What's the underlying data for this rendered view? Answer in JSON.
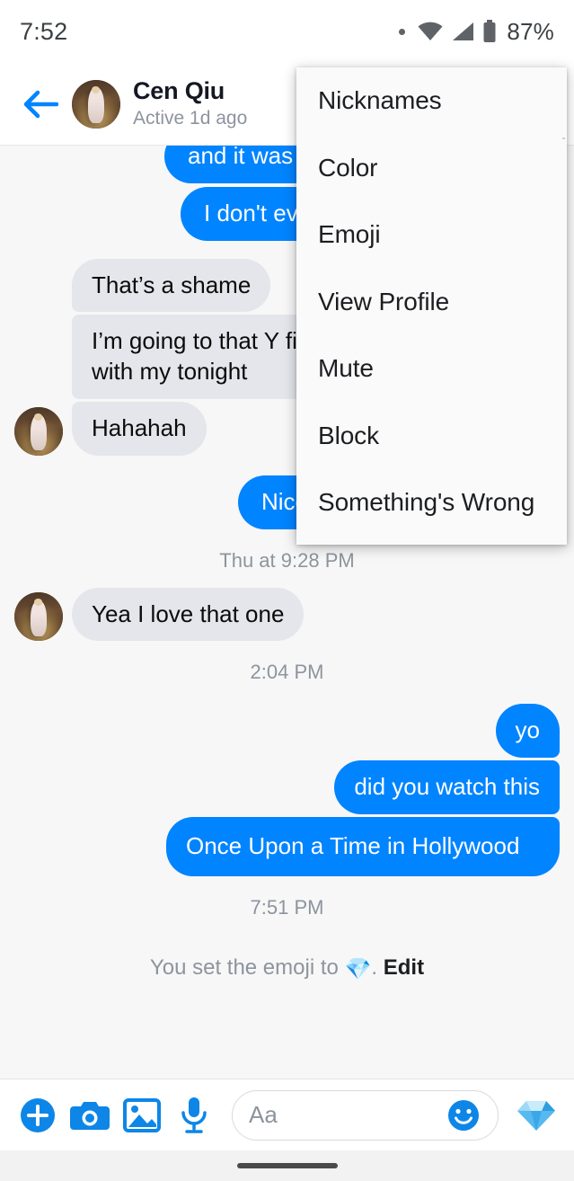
{
  "status_bar": {
    "clock": "7:52",
    "battery_percent": "87%",
    "icons": [
      "dot-indicator-icon",
      "wifi-icon",
      "cell-signal-icon",
      "battery-icon"
    ]
  },
  "header": {
    "back_icon": "back-arrow-icon",
    "name": "Cen Qiu",
    "active_status": "Active 1d ago"
  },
  "popup_menu": {
    "items": [
      {
        "label": "Nicknames"
      },
      {
        "label": "Color"
      },
      {
        "label": "Emoji"
      },
      {
        "label": "View Profile"
      },
      {
        "label": "Mute"
      },
      {
        "label": "Block"
      },
      {
        "label": "Something's Wrong"
      }
    ]
  },
  "conversation": [
    {
      "kind": "message",
      "side": "out",
      "text": "and it was s",
      "stack": "top",
      "clipped": true
    },
    {
      "kind": "message",
      "side": "out",
      "text": "I don't ever",
      "stack": "bot",
      "clipped": true
    },
    {
      "kind": "message",
      "side": "in",
      "text": "That’s a shame",
      "stack": "top",
      "avatar": false
    },
    {
      "kind": "message",
      "side": "in",
      "text": "I’m going to that Y⁠ fish place with my tonight",
      "stack": "mid",
      "avatar": false
    },
    {
      "kind": "message",
      "side": "in",
      "text": "Hahahah",
      "stack": "bot",
      "avatar": true
    },
    {
      "kind": "message",
      "side": "out",
      "text": "Nice.",
      "stack": "single",
      "clipped": true
    },
    {
      "kind": "timestamp",
      "text": "Thu at 9:28 PM"
    },
    {
      "kind": "message",
      "side": "in",
      "text": "Yea I love that one",
      "stack": "single",
      "avatar": true
    },
    {
      "kind": "timestamp",
      "text": "2:04 PM"
    },
    {
      "kind": "message",
      "side": "out",
      "text": "yo",
      "stack": "top"
    },
    {
      "kind": "message",
      "side": "out",
      "text": "did you watch this",
      "stack": "mid"
    },
    {
      "kind": "message",
      "side": "out",
      "text": "Once Upon a Time in Hollywood",
      "stack": "bot"
    },
    {
      "kind": "timestamp",
      "text": "7:51 PM"
    },
    {
      "kind": "system_note",
      "prefix": "You set the emoji to ",
      "emoji": "💎",
      "suffix": ". ",
      "action": "Edit"
    }
  ],
  "composer": {
    "placeholder": "Aa",
    "input_value": "",
    "icons": [
      "plus-circle-icon",
      "camera-icon",
      "gallery-icon",
      "microphone-icon"
    ],
    "emoji_button_icon": "smiley-face-icon",
    "quick_emoji": "💎",
    "quick_emoji_name": "gem-emoji-button"
  },
  "nav_bar": {
    "pill": "home-gesture-pill"
  },
  "colors": {
    "accent_blue": "#0084ff",
    "outgoing_bubble": "#0084ff",
    "incoming_bubble": "#e4e6eb",
    "chat_background": "#f7f7f7",
    "menu_background": "#fafafa",
    "muted_text": "#8d949e"
  }
}
